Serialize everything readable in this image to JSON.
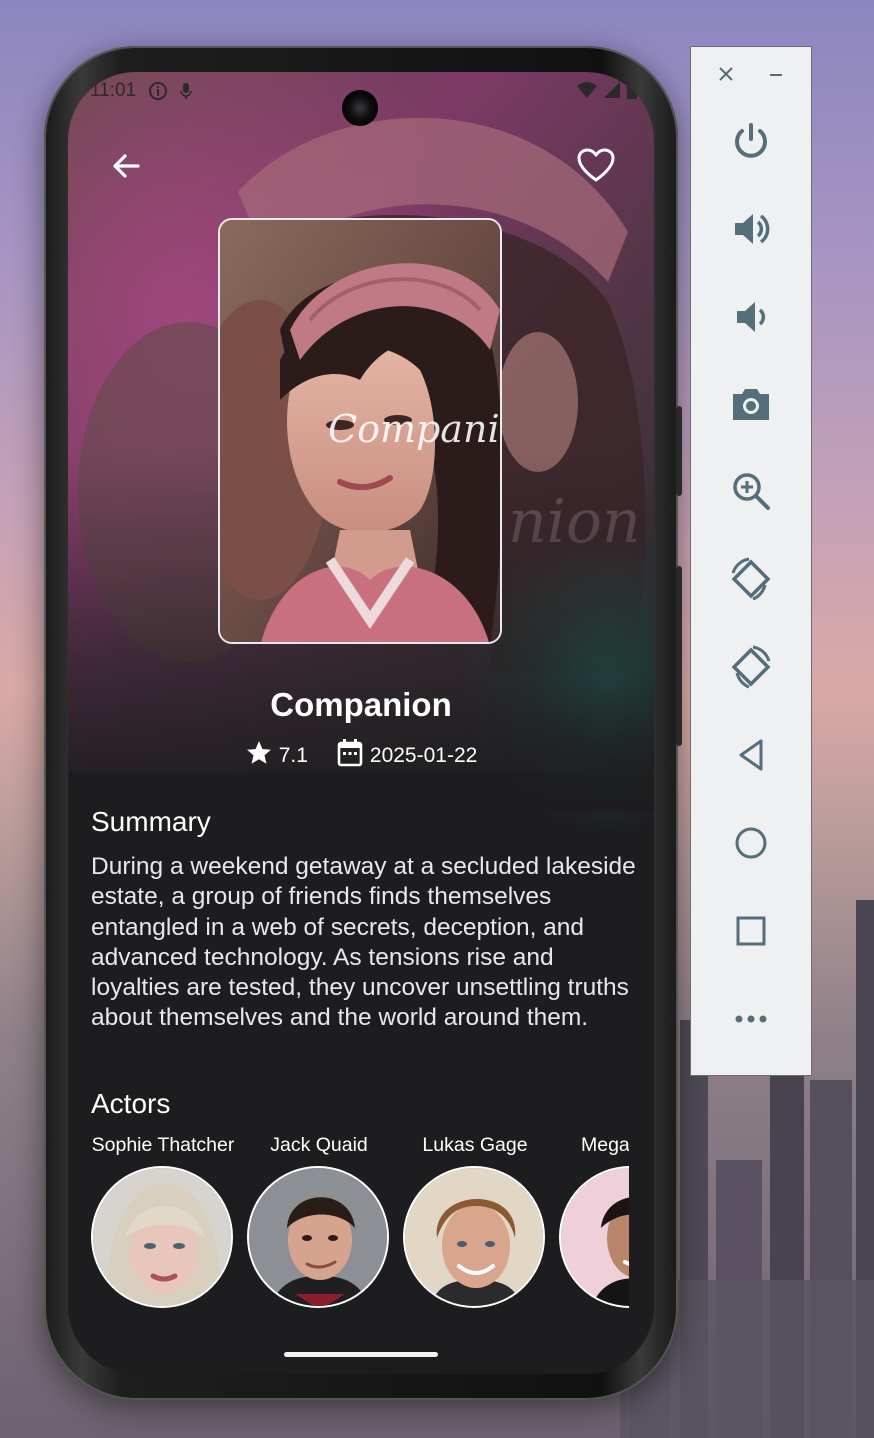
{
  "status_bar": {
    "time": "11:01"
  },
  "movie": {
    "title": "Companion",
    "poster_overlay_text": "Companion",
    "rating": "7.1",
    "release_date": "2025-01-22"
  },
  "summary": {
    "heading": "Summary",
    "text": "During a weekend getaway at a secluded lakeside estate, a group of friends finds themselves entangled in a web of secrets, deception, and advanced technology. As tensions rise and loyalties are tested, they uncover unsettling truths about themselves and the world around them."
  },
  "actors": {
    "heading": "Actors",
    "list": [
      {
        "name": "Sophie Thatcher"
      },
      {
        "name": "Jack Quaid"
      },
      {
        "name": "Lukas Gage"
      },
      {
        "name": "Mega"
      }
    ]
  },
  "icons": {
    "back": "arrow-back-icon",
    "favorite": "heart-outline-icon",
    "rating": "star-icon",
    "date": "calendar-icon"
  },
  "emulator_toolbar": {
    "buttons": [
      "close-icon",
      "minimize-icon",
      "power-icon",
      "volume-up-icon",
      "volume-down-icon",
      "camera-icon",
      "zoom-icon",
      "rotate-left-icon",
      "rotate-right-icon",
      "back-triangle-icon",
      "home-circle-icon",
      "overview-square-icon",
      "more-icon"
    ]
  },
  "colors": {
    "screen_bg": "#1d1d1f",
    "accent_teal": "#1e8270",
    "toolbar_icon": "#546e7a"
  }
}
